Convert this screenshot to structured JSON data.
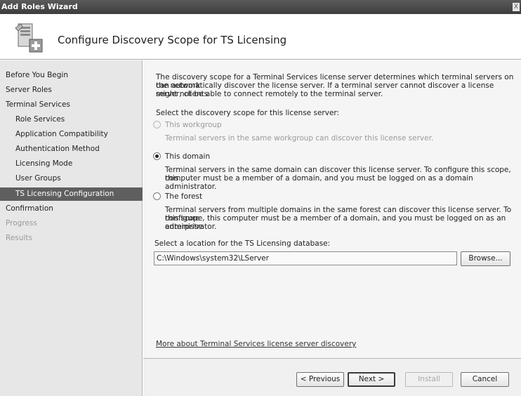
{
  "window": {
    "title": "Add Roles Wizard",
    "close_glyph": "X"
  },
  "header": {
    "title": "Configure Discovery Scope for TS Licensing",
    "icon": "server-add-icon"
  },
  "nav": {
    "items": [
      {
        "label": "Before You Begin",
        "level": 1,
        "state": "normal"
      },
      {
        "label": "Server Roles",
        "level": 1,
        "state": "normal"
      },
      {
        "label": "Terminal Services",
        "level": 1,
        "state": "normal"
      },
      {
        "label": "Role Services",
        "level": 2,
        "state": "normal"
      },
      {
        "label": "Application Compatibility",
        "level": 2,
        "state": "normal"
      },
      {
        "label": "Authentication Method",
        "level": 2,
        "state": "normal"
      },
      {
        "label": "Licensing Mode",
        "level": 2,
        "state": "normal"
      },
      {
        "label": "User Groups",
        "level": 2,
        "state": "normal"
      },
      {
        "label": "TS Licensing Configuration",
        "level": 2,
        "state": "selected"
      },
      {
        "label": "Confirmation",
        "level": 1,
        "state": "normal"
      },
      {
        "label": "Progress",
        "level": 1,
        "state": "disabled"
      },
      {
        "label": "Results",
        "level": 1,
        "state": "disabled"
      }
    ]
  },
  "content": {
    "intro_line1": "The discovery scope for a Terminal Services license server determines which terminal servers on the network",
    "intro_line2": "can automatically discover the license server. If a terminal server cannot discover a license server, clients",
    "intro_line3": "might not be able to connect remotely to the terminal server.",
    "select_scope_label": "Select the discovery scope for this license server:",
    "options": [
      {
        "label": "This workgroup",
        "desc1": "Terminal servers in the same workgroup can discover this license server.",
        "desc2": "",
        "desc3": "",
        "selected": false,
        "disabled": true
      },
      {
        "label": "This domain",
        "desc1": "Terminal servers in the same domain can discover this license server. To configure this scope, this",
        "desc2": "computer must be a member of a domain, and you must be logged on as a domain administrator.",
        "desc3": "",
        "selected": true,
        "disabled": false
      },
      {
        "label": "The forest",
        "desc1": "Terminal servers from multiple domains in the same forest can discover this license server. To configure",
        "desc2": "this scope, this computer must be a member of a domain, and you must be logged on as an enterprise",
        "desc3": "administrator.",
        "selected": false,
        "disabled": false
      }
    ],
    "location_label": "Select a location for the TS Licensing database:",
    "location_value": "C:\\Windows\\system32\\LServer",
    "browse_label": "Browse...",
    "more_link": "More about Terminal Services license server discovery"
  },
  "footer": {
    "previous_label": "< Previous",
    "next_label": "Next >",
    "install_label": "Install",
    "cancel_label": "Cancel"
  }
}
